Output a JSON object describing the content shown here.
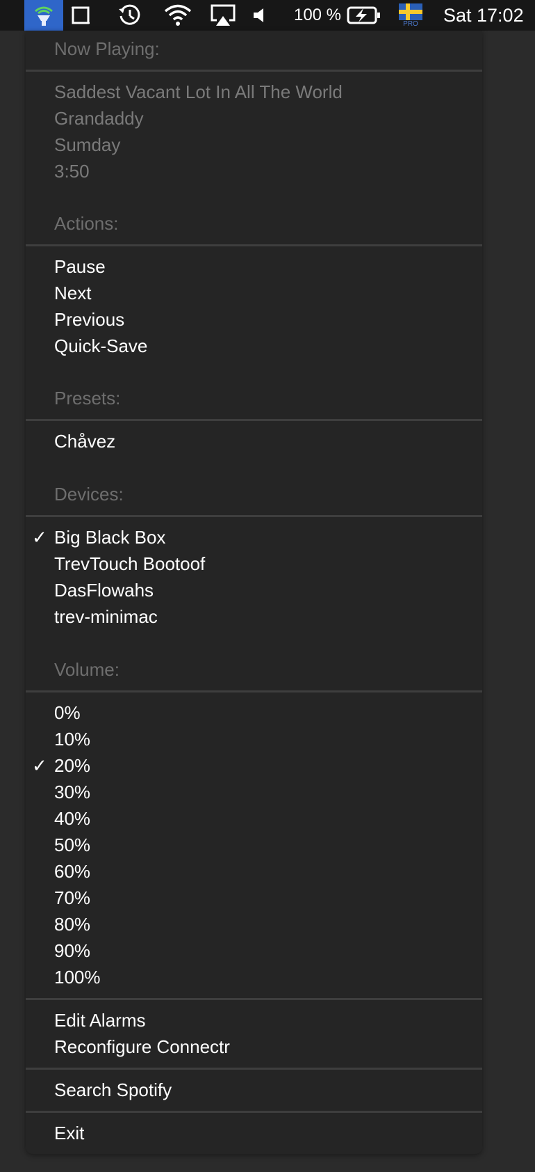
{
  "menubar": {
    "battery_text": "100 %",
    "clock": "Sat 17:02",
    "icons": [
      "connectr-app-icon",
      "window-icon",
      "time-machine-icon",
      "wifi-icon",
      "airplay-icon",
      "volume-icon",
      "battery-charging-icon",
      "swedish-flag-keyboard-icon"
    ],
    "flag_badge": "PRO"
  },
  "menu": {
    "now_playing": {
      "header": "Now Playing:",
      "track": "Saddest Vacant Lot In All The World",
      "artist": "Grandaddy",
      "album": "Sumday",
      "duration": "3:50"
    },
    "actions": {
      "header": "Actions:",
      "items": [
        "Pause",
        "Next",
        "Previous",
        "Quick-Save"
      ]
    },
    "presets": {
      "header": "Presets:",
      "items": [
        "Chåvez"
      ]
    },
    "devices": {
      "header": "Devices:",
      "items": [
        {
          "label": "Big Black Box",
          "checked": true
        },
        {
          "label": "TrevTouch Bootoof",
          "checked": false
        },
        {
          "label": "DasFlowahs",
          "checked": false
        },
        {
          "label": "trev-minimac",
          "checked": false
        }
      ]
    },
    "volume": {
      "header": "Volume:",
      "items": [
        {
          "label": "0%",
          "checked": false
        },
        {
          "label": "10%",
          "checked": false
        },
        {
          "label": "20%",
          "checked": true
        },
        {
          "label": "30%",
          "checked": false
        },
        {
          "label": "40%",
          "checked": false
        },
        {
          "label": "50%",
          "checked": false
        },
        {
          "label": "60%",
          "checked": false
        },
        {
          "label": "70%",
          "checked": false
        },
        {
          "label": "80%",
          "checked": false
        },
        {
          "label": "90%",
          "checked": false
        },
        {
          "label": "100%",
          "checked": false
        }
      ]
    },
    "check_mark": "✓",
    "edit_alarms": "Edit Alarms",
    "reconfigure": "Reconfigure Connectr",
    "search_spotify": "Search Spotify",
    "exit": "Exit"
  },
  "colors": {
    "menubar_bg": "#171717",
    "menu_bg": "#252525",
    "app_icon_highlight": "#2f66c9",
    "disabled_text": "#7a7a7a"
  }
}
